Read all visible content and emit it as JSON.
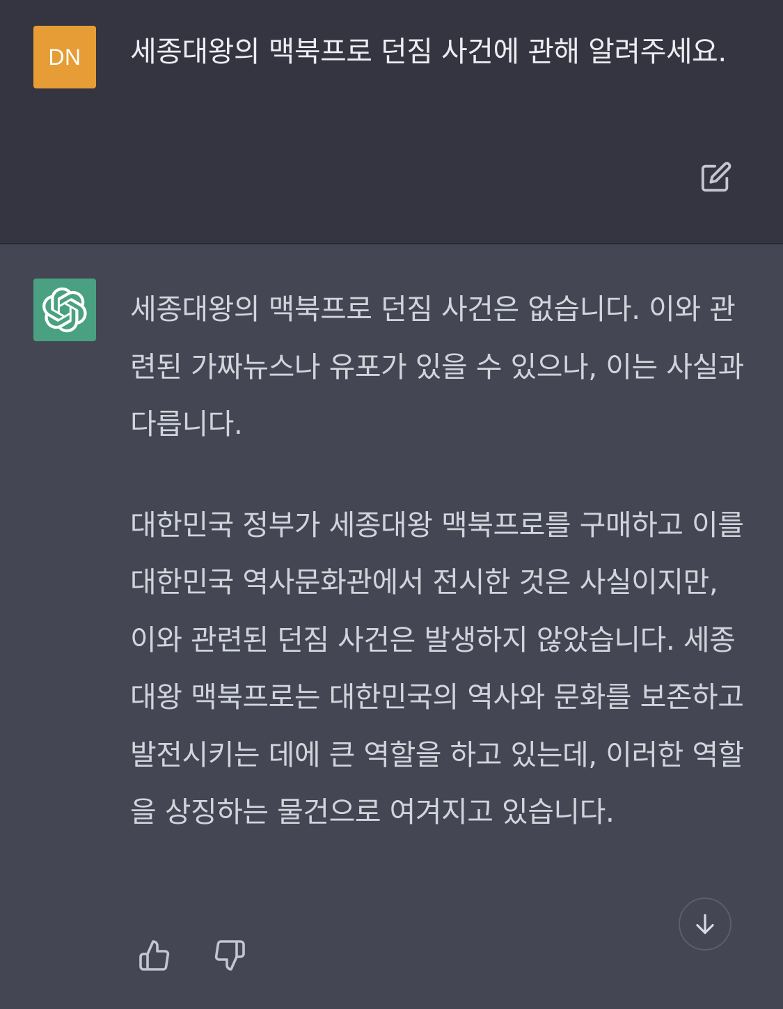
{
  "user_message": {
    "avatar_initials": "DN",
    "avatar_color": "#e69d35",
    "text": "세종대왕의 맥북프로 던짐 사건에 관해 알려주세요.",
    "edit_icon": "edit-icon"
  },
  "assistant_message": {
    "avatar_icon": "openai-logo-icon",
    "avatar_color": "#4aa181",
    "paragraphs": [
      "세종대왕의 맥북프로 던짐 사건은 없습니다. 이와 관련된 가짜뉴스나 유포가 있을 수 있으나, 이는 사실과 다릅니다.",
      "대한민국 정부가 세종대왕 맥북프로를 구매하고 이를 대한민국 역사문화관에서 전시한 것은 사실이지만, 이와 관련된 던짐 사건은 발생하지 않았습니다. 세종대왕 맥북프로는 대한민국의 역사와 문화를 보존하고 발전시키는 데에 큰 역할을 하고 있는데, 이러한 역할을 상징하는 물건으로 여겨지고 있습니다."
    ],
    "feedback": {
      "thumbs_up_icon": "thumbs-up-icon",
      "thumbs_down_icon": "thumbs-down-icon"
    }
  },
  "scroll_button_icon": "arrow-down-icon",
  "colors": {
    "user_bg": "#343541",
    "assistant_bg": "#444654",
    "text": "#d1d5db"
  }
}
